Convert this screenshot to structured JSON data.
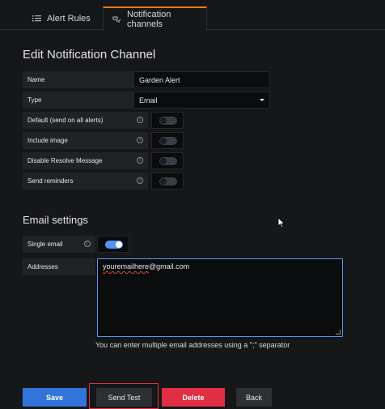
{
  "tabs": {
    "alert_rules": "Alert Rules",
    "notification_channels": "Notification channels"
  },
  "page_title": "Edit Notification Channel",
  "fields": {
    "name_label": "Name",
    "name_value": "Garden Alert",
    "type_label": "Type",
    "type_value": "Email",
    "default_label": "Default (send on all alerts)",
    "default_on": false,
    "include_image_label": "Include image",
    "include_image_on": false,
    "disable_resolve_label": "Disable Resolve Message",
    "disable_resolve_on": false,
    "send_reminders_label": "Send reminders",
    "send_reminders_on": false
  },
  "email_settings": {
    "title": "Email settings",
    "single_email_label": "Single email",
    "single_email_on": true,
    "addresses_label": "Addresses",
    "addresses_typo_part": "youremailhere",
    "addresses_rest": "@gmail.com",
    "hint": "You can enter multiple email addresses using a \";\" separator"
  },
  "buttons": {
    "save": "Save",
    "send_test": "Send Test",
    "delete": "Delete",
    "back": "Back"
  },
  "icons": {
    "alert_rules": "list-icon",
    "notification_channels": "channel-icon",
    "info": "info-icon"
  },
  "colors": {
    "accent_tab": "#eb7b18",
    "primary": "#3274d9",
    "danger": "#e02f44",
    "toggle_on": "#5794f2"
  }
}
